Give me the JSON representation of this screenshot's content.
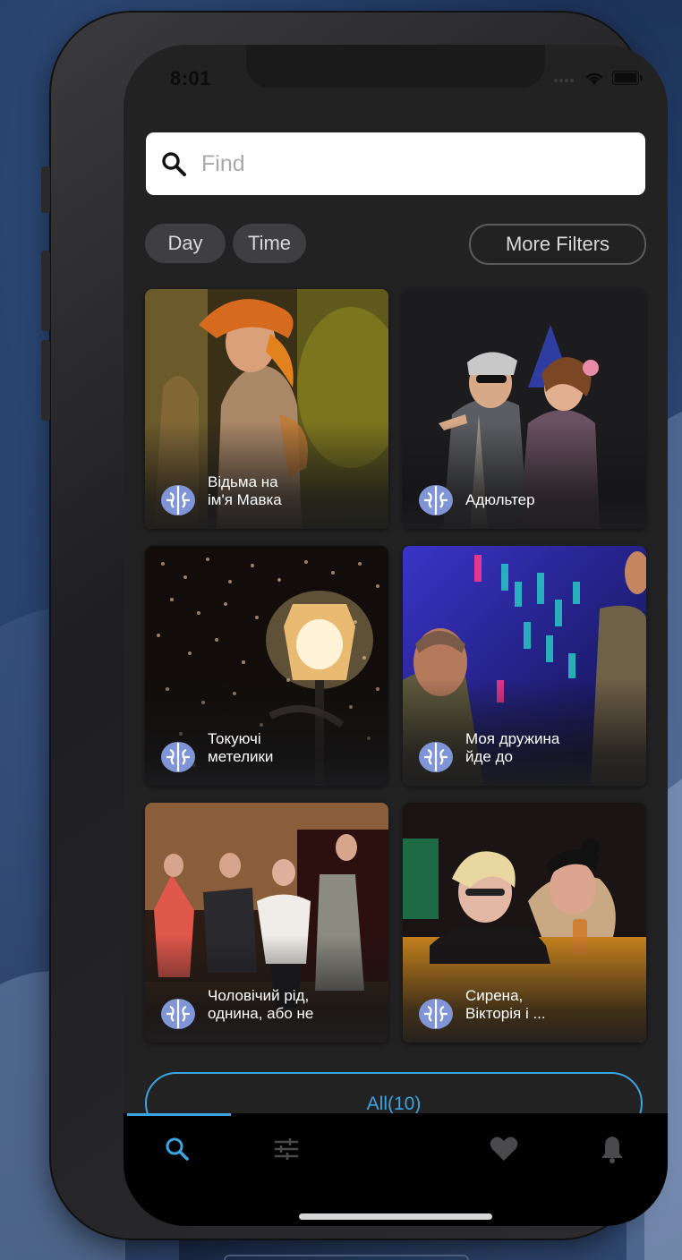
{
  "status": {
    "time": "8:01"
  },
  "search": {
    "placeholder": "Find"
  },
  "filters": {
    "day": "Day",
    "time": "Time",
    "more": "More Filters"
  },
  "cards": [
    {
      "title": "Відьма на\nім'я Мавка"
    },
    {
      "title": "Адюльтер"
    },
    {
      "title": "Токуючі\nметелики"
    },
    {
      "title": "Моя дружина\nйде до"
    },
    {
      "title": "Чоловічий рід,\nоднина, або не"
    },
    {
      "title": "Сирена,\nВікторія і ..."
    }
  ],
  "all_button": "All(10)",
  "tabs": [
    "search-icon",
    "sliders-icon",
    "heart-icon",
    "bell-icon"
  ],
  "colors": {
    "accent": "#3aa5e3",
    "card_icon": "#7f95d6"
  }
}
